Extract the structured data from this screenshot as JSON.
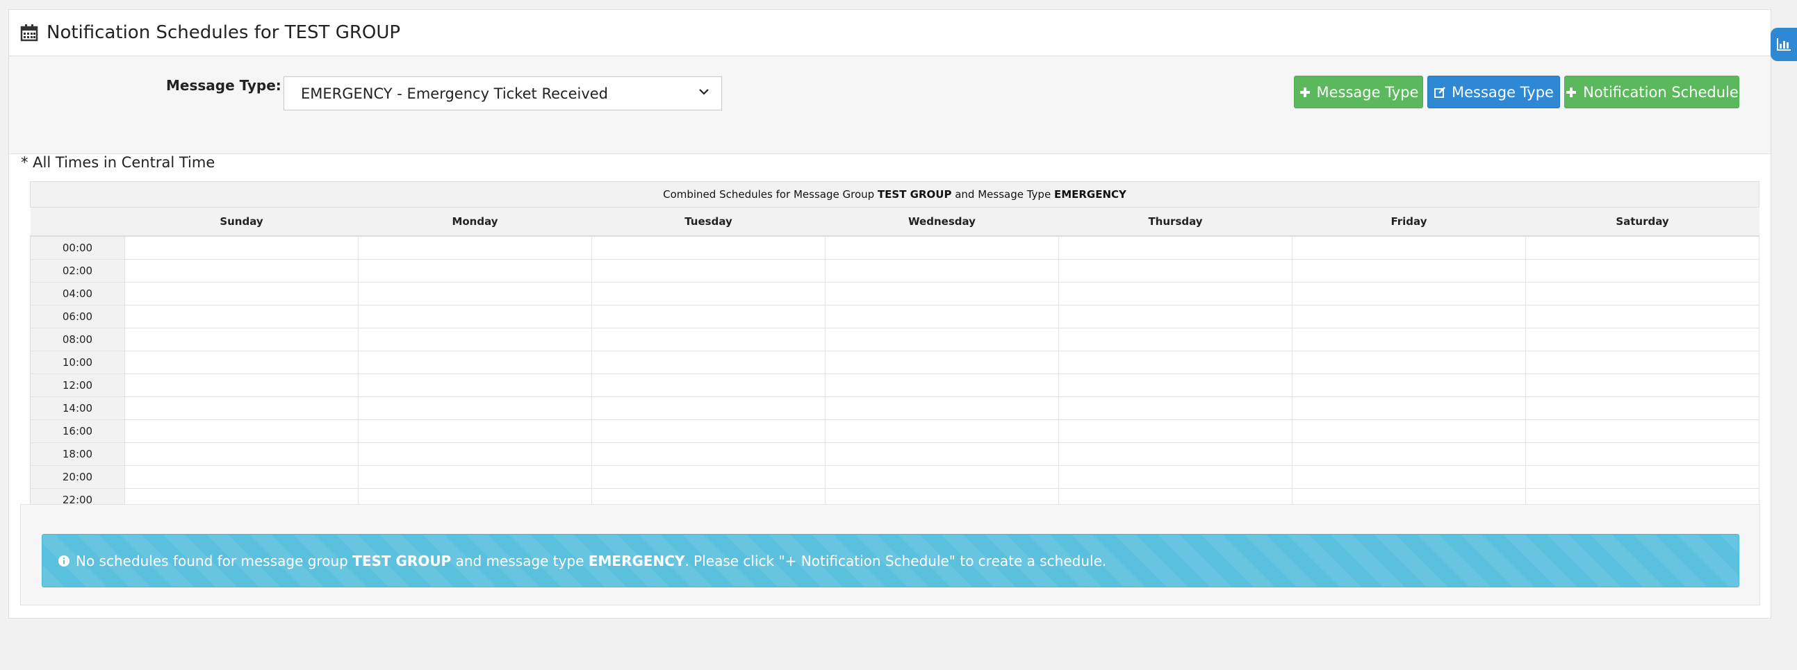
{
  "header": {
    "title": "Notification Schedules for TEST GROUP"
  },
  "filter": {
    "label": "Message Type:",
    "selected": "EMERGENCY - Emergency Ticket Received"
  },
  "buttons": {
    "add_message_type": "Message Type",
    "edit_message_type": "Message Type",
    "add_notification_schedule": "Notification Schedule"
  },
  "timezone_note": "* All Times in Central Time",
  "schedule": {
    "title_prefix": "Combined Schedules for Message Group ",
    "group": "TEST GROUP",
    "title_middle": " and Message Type ",
    "type": "EMERGENCY",
    "days": [
      "Sunday",
      "Monday",
      "Tuesday",
      "Wednesday",
      "Thursday",
      "Friday",
      "Saturday"
    ],
    "hours": [
      "00:00",
      "02:00",
      "04:00",
      "06:00",
      "08:00",
      "10:00",
      "12:00",
      "14:00",
      "16:00",
      "18:00",
      "20:00",
      "22:00"
    ]
  },
  "alert": {
    "prefix": "No schedules found for message group ",
    "group": "TEST GROUP",
    "middle": " and message type ",
    "type": "EMERGENCY",
    "suffix": ". Please click \"+ Notification Schedule\" to create a schedule."
  },
  "icons": {
    "heading": "calendar-icon",
    "add": "plus-icon",
    "edit": "edit-icon",
    "info": "info-circle-icon",
    "side_tab": "bar-chart-icon"
  },
  "colors": {
    "green": "#5cb85c",
    "blue": "#2f88d4",
    "info": "#5bc0de"
  }
}
